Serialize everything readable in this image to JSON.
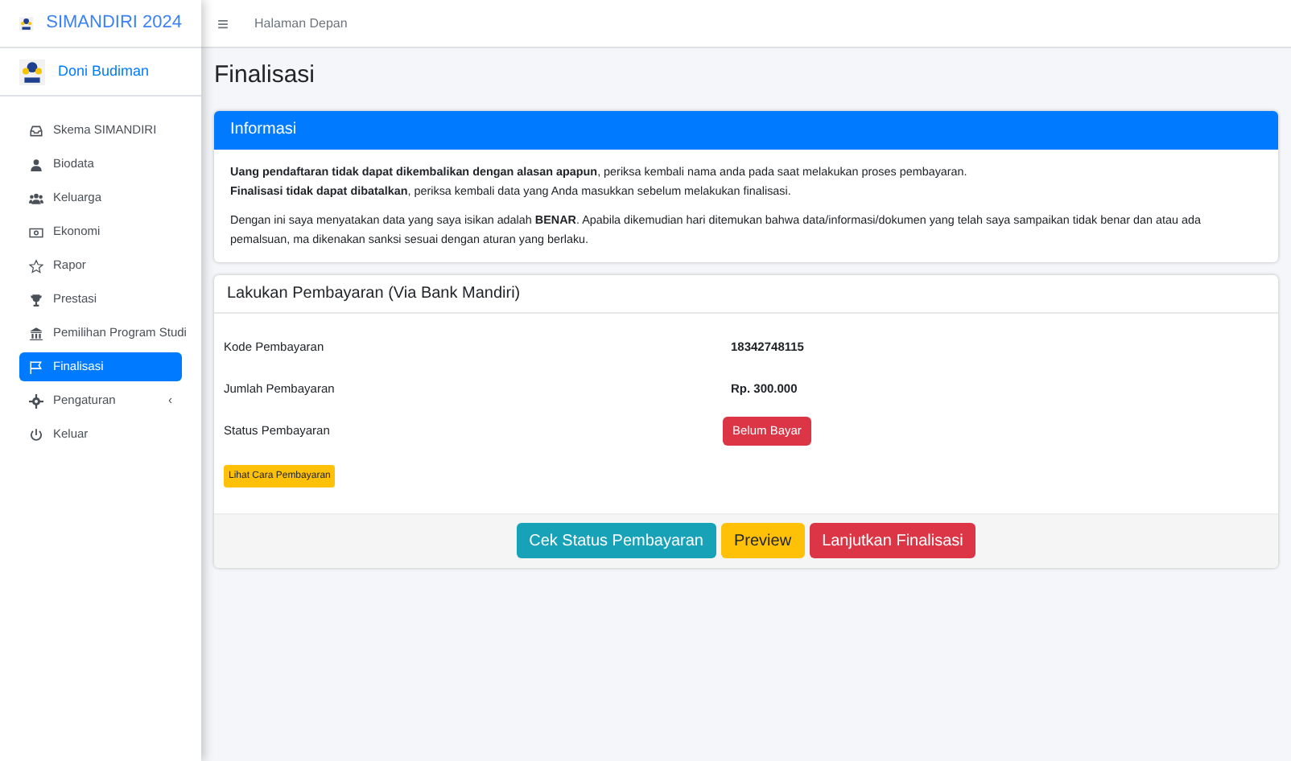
{
  "brand": {
    "title": "SIMANDIRI 2024"
  },
  "user": {
    "name": "Doni Budiman"
  },
  "sidebar": {
    "items": [
      {
        "label": "Skema SIMANDIRI",
        "selected": false
      },
      {
        "label": "Biodata",
        "selected": false
      },
      {
        "label": "Keluarga",
        "selected": false
      },
      {
        "label": "Ekonomi",
        "selected": false
      },
      {
        "label": "Rapor",
        "selected": false
      },
      {
        "label": "Prestasi",
        "selected": false
      },
      {
        "label": "Pemilihan Program Studi",
        "selected": false
      },
      {
        "label": "Finalisasi",
        "selected": true
      },
      {
        "label": "Pengaturan",
        "selected": false,
        "caret": "‹"
      },
      {
        "label": "Keluar",
        "selected": false
      }
    ]
  },
  "topbar": {
    "menu_glyph": "≡",
    "breadcrumb": "Halaman Depan"
  },
  "page_title": "Finalisasi",
  "info_card": {
    "title": "Informasi",
    "lines": [
      "**Uang pendaftaran tidak dapat dikembalikan dengan alasan apapun**, periksa kembali nama anda pada saat melakukan proses pembayaran.",
      "**Finalisasi tidak dapat dibatalkan**, periksa kembali data yang Anda masukkan sebelum melakukan finalisasi."
    ],
    "statement": "Dengan ini saya menyatakan data yang saya isikan adalah **BENAR**. Apabila dikemudian hari ditemukan bahwa data/informasi/dokumen yang telah saya sampaikan tidak benar dan atau ada pemalsuan, ma dikenakan sanksi sesuai dengan aturan yang berlaku."
  },
  "payment_card": {
    "title": "Lakukan Pembayaran (Via Bank Mandiri)",
    "rows": [
      {
        "label": "Kode Pembayaran",
        "value": "18342748115",
        "kind": "text"
      },
      {
        "label": "Jumlah Pembayaran",
        "value": "Rp. 300.000",
        "kind": "text"
      },
      {
        "label": "Status Pembayaran",
        "value": "Belum Bayar",
        "kind": "badge"
      }
    ],
    "guide_button": "Lihat Cara Pembayaran",
    "buttons": [
      {
        "label": "Cek Status Pembayaran",
        "kind": "info"
      },
      {
        "label": "Preview",
        "kind": "warning"
      },
      {
        "label": "Lanjutkan Finalisasi",
        "kind": "danger"
      }
    ]
  }
}
